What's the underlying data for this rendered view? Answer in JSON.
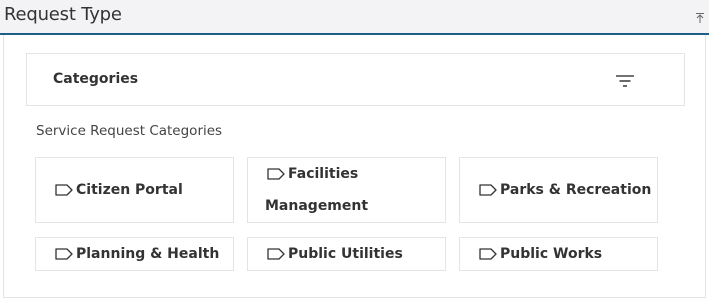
{
  "panel": {
    "title": "Request Type",
    "collapse_icon": "collapse-up-icon",
    "accent_color": "#1f5f86"
  },
  "filter_bar": {
    "label": "Categories",
    "icon": "filter-icon"
  },
  "section": {
    "label": "Service Request Categories"
  },
  "categories": [
    {
      "label": "Citizen Portal",
      "icon": "tag-icon"
    },
    {
      "label": "Facilities",
      "label_line2": "Management",
      "icon": "tag-icon"
    },
    {
      "label": "Parks & Recreation",
      "icon": "tag-icon"
    },
    {
      "label": "Planning & Health",
      "icon": "tag-icon"
    },
    {
      "label": "Public Utilities",
      "icon": "tag-icon"
    },
    {
      "label": "Public Works",
      "icon": "tag-icon"
    }
  ]
}
